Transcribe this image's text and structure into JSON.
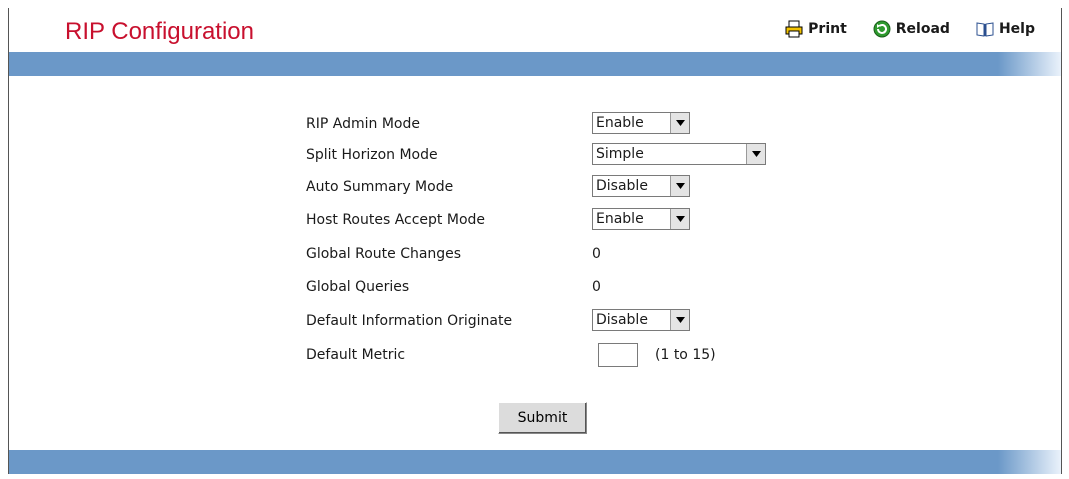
{
  "header": {
    "title": "RIP Configuration",
    "print_label": "Print",
    "reload_label": "Reload",
    "help_label": "Help"
  },
  "form": {
    "rip_admin_mode": {
      "label": "RIP Admin Mode",
      "value": "Enable"
    },
    "split_horizon_mode": {
      "label": "Split Horizon Mode",
      "value": "Simple"
    },
    "auto_summary_mode": {
      "label": "Auto Summary Mode",
      "value": "Disable"
    },
    "host_routes_accept_mode": {
      "label": "Host Routes Accept Mode",
      "value": "Enable"
    },
    "global_route_changes": {
      "label": "Global Route Changes",
      "value": "0"
    },
    "global_queries": {
      "label": "Global Queries",
      "value": "0"
    },
    "default_information_originate": {
      "label": "Default Information Originate",
      "value": "Disable"
    },
    "default_metric": {
      "label": "Default Metric",
      "value": "",
      "range": "(1 to 15)"
    },
    "submit_label": "Submit"
  },
  "colors": {
    "title": "#c8102e",
    "bar": "#6b98c8"
  }
}
